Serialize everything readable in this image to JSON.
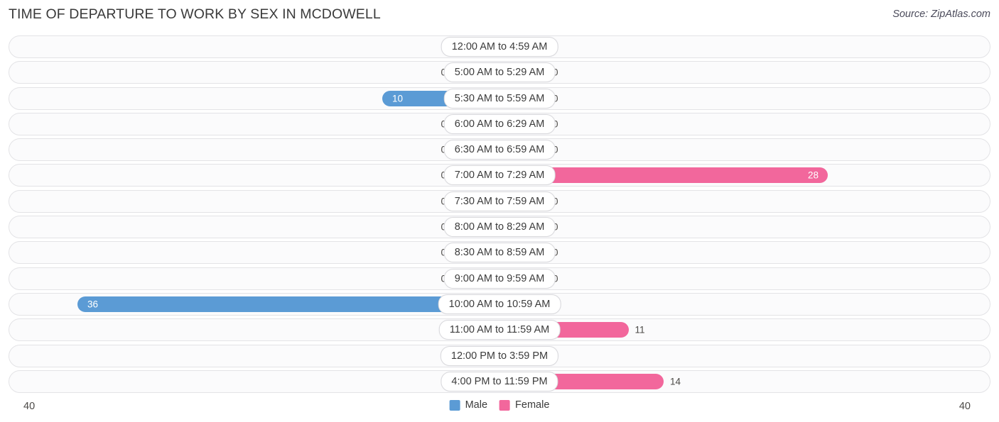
{
  "header": {
    "title": "TIME OF DEPARTURE TO WORK BY SEX IN MCDOWELL",
    "source": "Source: ZipAtlas.com"
  },
  "legend": {
    "items": [
      {
        "label": "Male",
        "color": "#5B9BD5"
      },
      {
        "label": "Female",
        "color": "#F2679C"
      }
    ]
  },
  "axis": {
    "left_max": "40",
    "right_max": "40"
  },
  "colors": {
    "male": "#5B9BD5",
    "male_zero": "#A8C8EC",
    "female": "#F2679C",
    "female_zero": "#F7AEC8",
    "row_track": "#fbfbfc",
    "row_border": "#e3e3e6"
  },
  "chart_data": {
    "type": "bar",
    "title": "TIME OF DEPARTURE TO WORK BY SEX IN MCDOWELL",
    "subtitle": "",
    "orientation": "horizontal-diverging",
    "xlabel": "",
    "ylabel": "",
    "xlim": [
      40,
      40
    ],
    "axis_max": 40,
    "grid": false,
    "legend_position": "bottom-center",
    "categories": [
      "12:00 AM to 4:59 AM",
      "5:00 AM to 5:29 AM",
      "5:30 AM to 5:59 AM",
      "6:00 AM to 6:29 AM",
      "6:30 AM to 6:59 AM",
      "7:00 AM to 7:29 AM",
      "7:30 AM to 7:59 AM",
      "8:00 AM to 8:29 AM",
      "8:30 AM to 8:59 AM",
      "9:00 AM to 9:59 AM",
      "10:00 AM to 10:59 AM",
      "11:00 AM to 11:59 AM",
      "12:00 PM to 3:59 PM",
      "4:00 PM to 11:59 PM"
    ],
    "series": [
      {
        "name": "Male",
        "color": "#5B9BD5",
        "side": "left",
        "values": [
          0,
          0,
          10,
          0,
          0,
          0,
          0,
          0,
          0,
          0,
          36,
          0,
          0,
          0
        ]
      },
      {
        "name": "Female",
        "color": "#F2679C",
        "side": "right",
        "values": [
          0,
          0,
          0,
          0,
          0,
          28,
          0,
          0,
          0,
          0,
          0,
          11,
          0,
          14
        ]
      }
    ]
  },
  "rows": [
    {
      "label": "12:00 AM to 4:59 AM",
      "male": "0",
      "female": "0"
    },
    {
      "label": "5:00 AM to 5:29 AM",
      "male": "0",
      "female": "0"
    },
    {
      "label": "5:30 AM to 5:59 AM",
      "male": "10",
      "female": "0"
    },
    {
      "label": "6:00 AM to 6:29 AM",
      "male": "0",
      "female": "0"
    },
    {
      "label": "6:30 AM to 6:59 AM",
      "male": "0",
      "female": "0"
    },
    {
      "label": "7:00 AM to 7:29 AM",
      "male": "0",
      "female": "28"
    },
    {
      "label": "7:30 AM to 7:59 AM",
      "male": "0",
      "female": "0"
    },
    {
      "label": "8:00 AM to 8:29 AM",
      "male": "0",
      "female": "0"
    },
    {
      "label": "8:30 AM to 8:59 AM",
      "male": "0",
      "female": "0"
    },
    {
      "label": "9:00 AM to 9:59 AM",
      "male": "0",
      "female": "0"
    },
    {
      "label": "10:00 AM to 10:59 AM",
      "male": "36",
      "female": "0"
    },
    {
      "label": "11:00 AM to 11:59 AM",
      "male": "0",
      "female": "11"
    },
    {
      "label": "12:00 PM to 3:59 PM",
      "male": "0",
      "female": "0"
    },
    {
      "label": "4:00 PM to 11:59 PM",
      "male": "0",
      "female": "14"
    }
  ]
}
